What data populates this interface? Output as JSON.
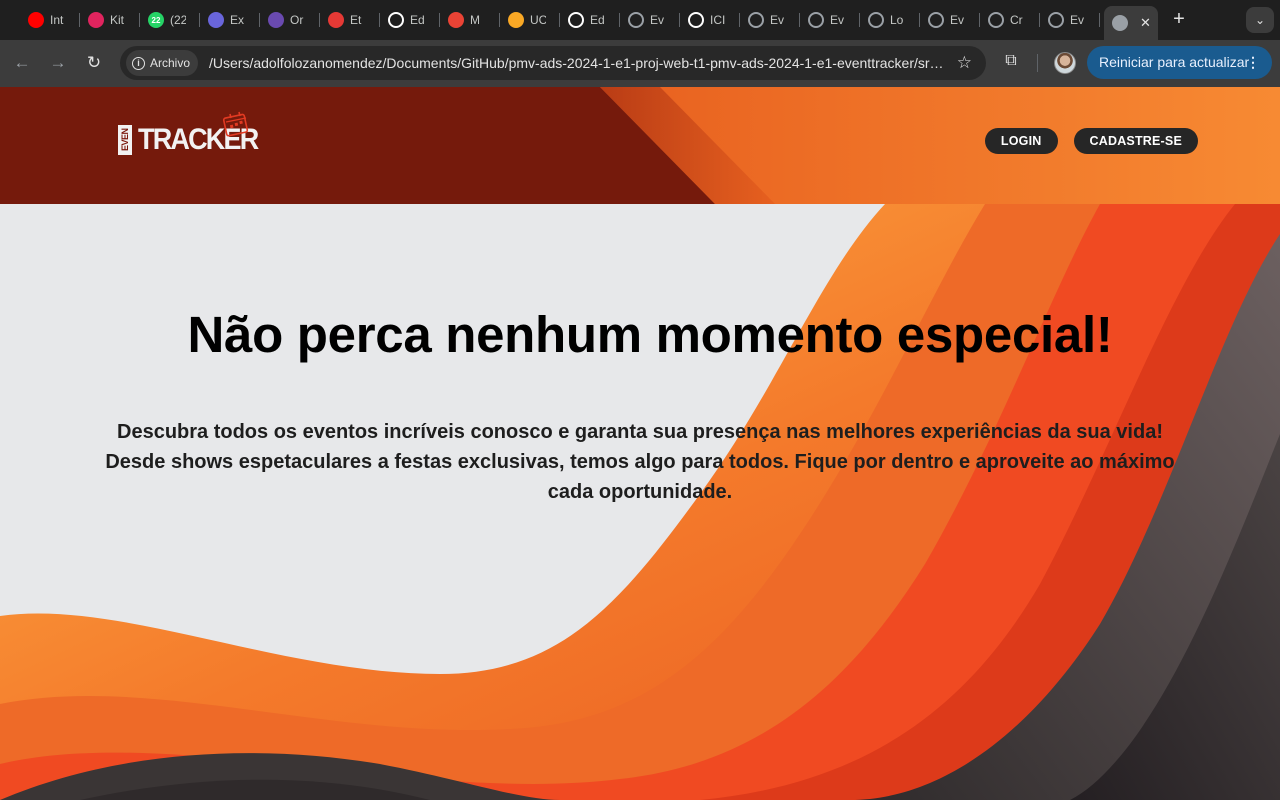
{
  "browser": {
    "tabs": [
      {
        "title": "Int",
        "icon": "youtube-icon",
        "color": "#ff0000"
      },
      {
        "title": "Kit",
        "icon": "kit-icon",
        "color": "#e0245e"
      },
      {
        "title": "(22",
        "icon": "whatsapp-icon",
        "color": "#25d366",
        "badge": "22"
      },
      {
        "title": "Ex",
        "icon": "excalidraw-icon",
        "color": "#6965db"
      },
      {
        "title": "Or",
        "icon": "bolt-icon",
        "color": "#6a4ab0"
      },
      {
        "title": "Et",
        "icon": "loader-icon",
        "color": "#e53935"
      },
      {
        "title": "Ed",
        "icon": "github-icon",
        "color": "#ffffff"
      },
      {
        "title": "M",
        "icon": "gmail-icon",
        "color": "#ea4335"
      },
      {
        "title": "UC",
        "icon": "uc-icon",
        "color": "#f9a825"
      },
      {
        "title": "Ed",
        "icon": "github-icon",
        "color": "#ffffff"
      },
      {
        "title": "Ev",
        "icon": "globe-icon",
        "color": "#9aa0a6"
      },
      {
        "title": "ICI",
        "icon": "github-icon",
        "color": "#ffffff"
      },
      {
        "title": "Ev",
        "icon": "globe-icon",
        "color": "#9aa0a6"
      },
      {
        "title": "Ev",
        "icon": "globe-icon",
        "color": "#9aa0a6"
      },
      {
        "title": "Lo",
        "icon": "globe-icon",
        "color": "#9aa0a6"
      },
      {
        "title": "Ev",
        "icon": "globe-icon",
        "color": "#9aa0a6"
      },
      {
        "title": "Cr",
        "icon": "globe-icon",
        "color": "#9aa0a6"
      },
      {
        "title": "Ev",
        "icon": "globe-icon",
        "color": "#9aa0a6"
      }
    ],
    "active_tab_close": "✕",
    "new_tab": "+",
    "security_chip": "Archivo",
    "url": "/Users/adolfolozanomendez/Documents/GitHub/pmv-ads-2024-1-e1-proj-web-t1-pmv-ads-2024-1-e1-eventtracker/src/index.html",
    "update_button": "Reiniciar para actualizar",
    "update_menu": "⋮"
  },
  "site": {
    "logo": {
      "small": "EVEN",
      "main": "TRACKER"
    },
    "nav": {
      "login": "LOGIN",
      "signup": "CADASTRE-SE"
    },
    "hero": {
      "title": "Não perca nenhum momento especial!",
      "text": "Descubra todos os eventos incríveis conosco e garanta sua presença nas melhores experiências da sua vida! Desde shows espetaculares a festas exclusivas, temos algo para todos. Fique por dentro e aproveite ao máximo cada oportunidade."
    }
  },
  "colors": {
    "header_dark": "#6e140b",
    "header_orange": "#f68530",
    "wave_orange": "#f47a2b",
    "wave_red": "#e8351a",
    "wave_dark": "#3a3535",
    "pill_bg": "#262626",
    "page_bg": "#e7e8ea"
  }
}
